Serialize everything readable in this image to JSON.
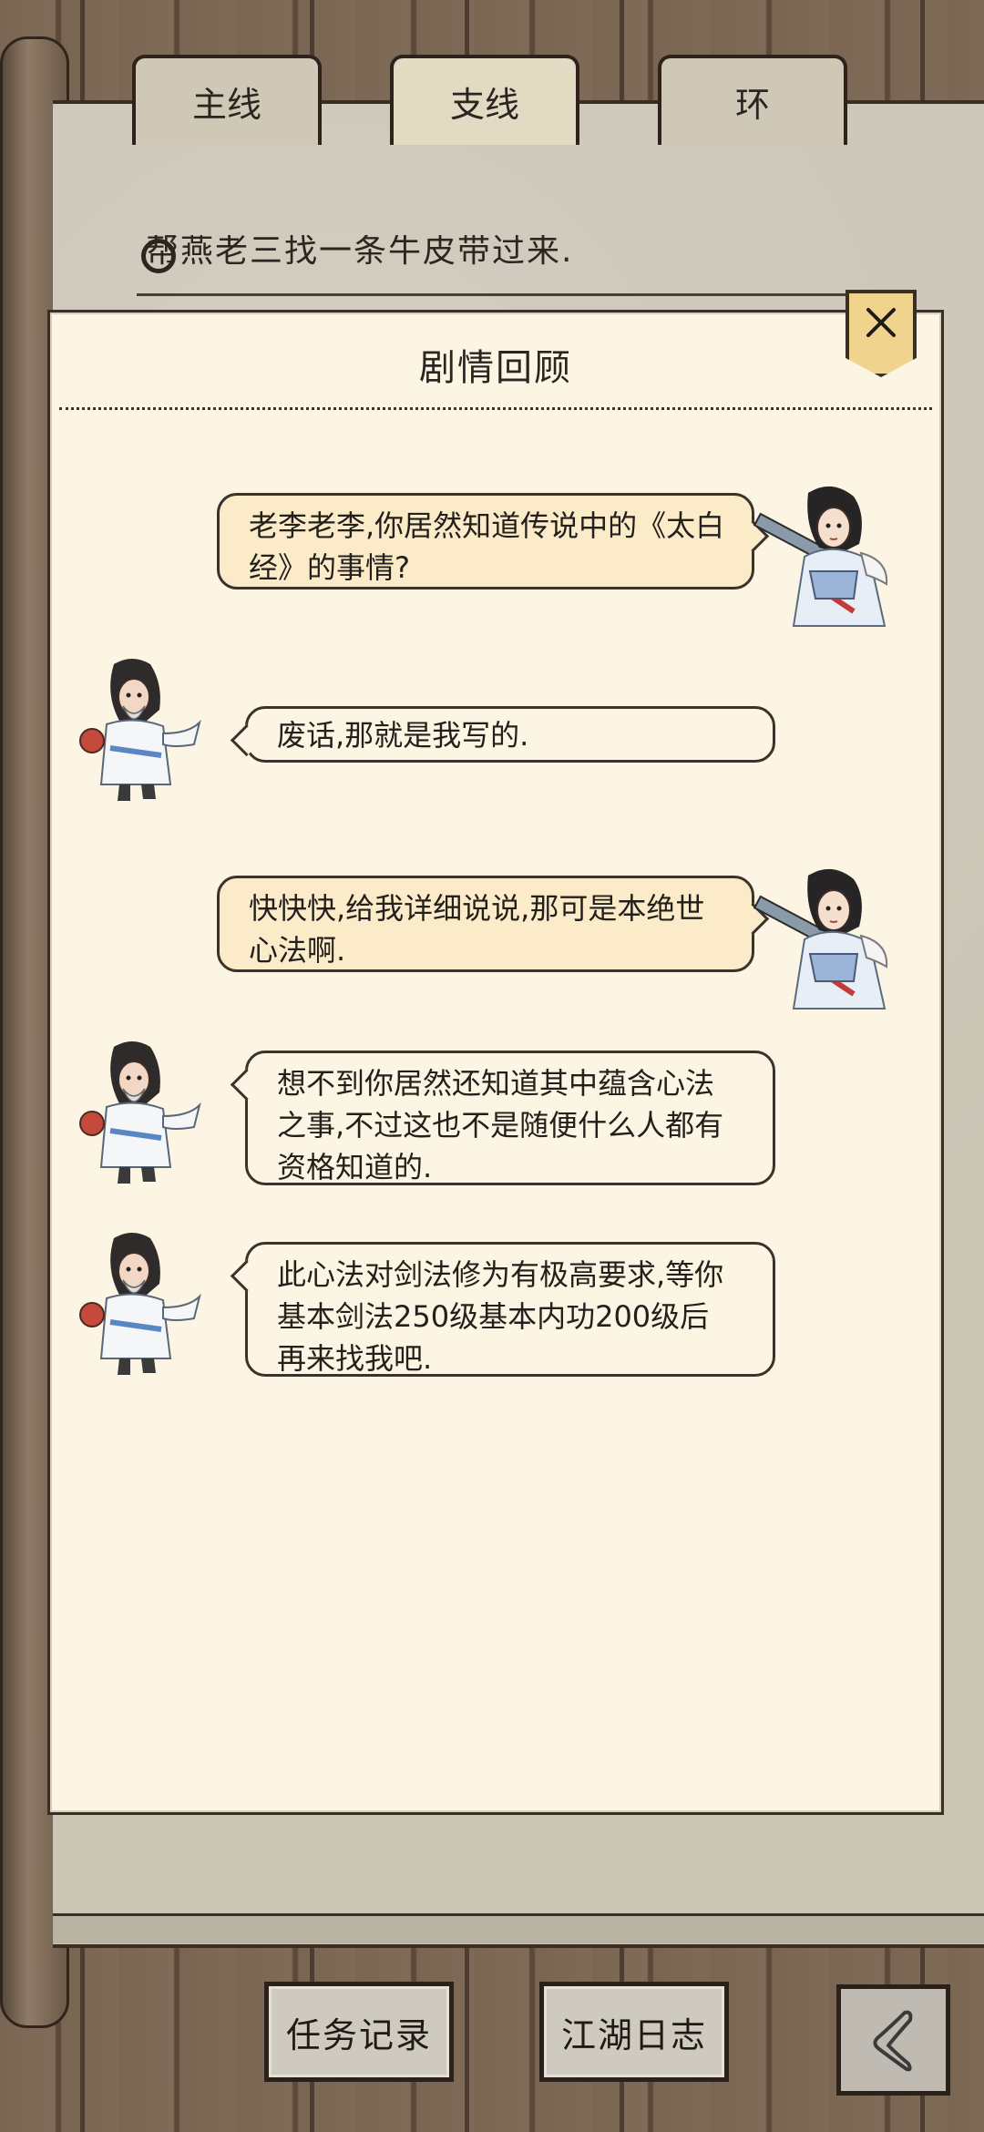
{
  "tabs": [
    {
      "label": "主线",
      "active": false
    },
    {
      "label": "支线",
      "active": true
    },
    {
      "label": "环",
      "active": false
    }
  ],
  "quest_line": "帮燕老三找一条牛皮带过来.",
  "dialog": {
    "title": "剧情回顾",
    "close_icon": "close-x-icon",
    "messages": [
      {
        "speaker": "heroine",
        "side": "right",
        "text_lines": [
          "老李老李,你居然知道传说中的《太白",
          "经》的事情?"
        ]
      },
      {
        "speaker": "old-li",
        "side": "left",
        "text_lines": [
          "废话,那就是我写的."
        ]
      },
      {
        "speaker": "heroine",
        "side": "right",
        "text_lines": [
          "快快快,给我详细说说,那可是本绝世",
          "心法啊."
        ]
      },
      {
        "speaker": "old-li",
        "side": "left",
        "text_lines": [
          "想不到你居然还知道其中蕴含心法",
          "之事,不过这也不是随便什么人都有",
          "资格知道的."
        ]
      },
      {
        "speaker": "old-li",
        "side": "left",
        "text_lines": [
          "此心法对剑法修为有极高要求,等你",
          "基本剑法250级基本内功200级后",
          "再来找我吧."
        ]
      }
    ]
  },
  "bottom": {
    "task_record": "任务记录",
    "journal": "江湖日志",
    "back_icon": "back-arrow-icon"
  },
  "colors": {
    "dialog_bg": "#fdf5e3",
    "right_bubble": "#fcebc8",
    "close_button": "#f0d48e",
    "wood": "#7b6654"
  }
}
